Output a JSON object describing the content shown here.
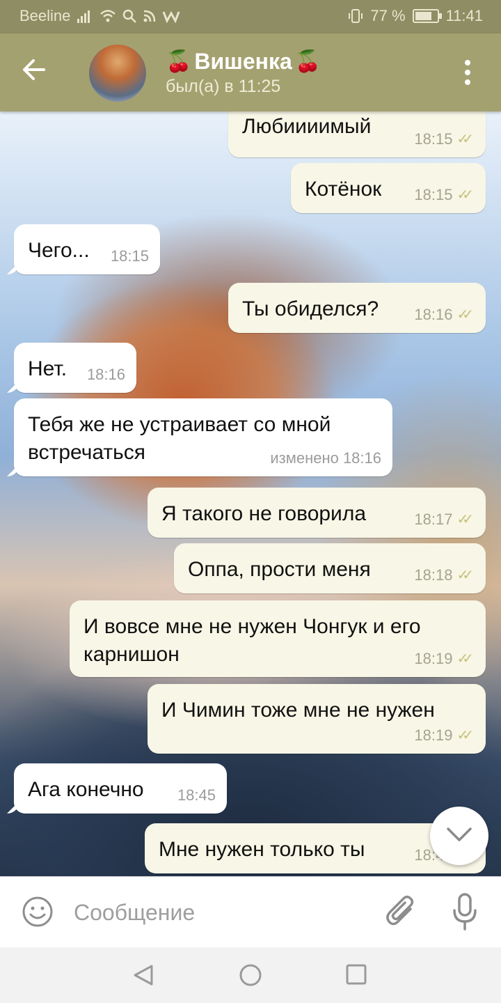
{
  "status_bar": {
    "carrier": "Beeline",
    "battery_text": "77 %",
    "battery_level": 0.77,
    "time": "11:41",
    "icons": [
      "signal-icon",
      "wifi-icon",
      "search-icon",
      "rss-icon",
      "w-icon",
      "vibrate-icon",
      "battery-icon"
    ]
  },
  "header": {
    "contact_name": "Вишенка",
    "name_emoji": "🍒",
    "last_seen": "был(а) в 11:25"
  },
  "messages": [
    {
      "text": "Любиииимый",
      "time": "18:15",
      "outgoing": true,
      "read": true
    },
    {
      "text": "Котёнок",
      "time": "18:15",
      "outgoing": true,
      "read": true
    },
    {
      "text": "Чего...",
      "time": "18:15",
      "outgoing": false
    },
    {
      "text": "Ты обиделся?",
      "time": "18:16",
      "outgoing": true,
      "read": true
    },
    {
      "text": "Нет.",
      "time": "18:16",
      "outgoing": false
    },
    {
      "line1": "Тебя же не устраивает со мной",
      "line2": "встречаться",
      "time": "изменено 18:16",
      "outgoing": false
    },
    {
      "text": "Я такого не говорила",
      "time": "18:17",
      "outgoing": true,
      "read": true
    },
    {
      "text": "Оппа, прости меня",
      "time": "18:18",
      "outgoing": true,
      "read": true
    },
    {
      "line1": "И вовсе мне не нужен Чонгук и его",
      "line2": "карнишон",
      "time": "18:19",
      "outgoing": true,
      "read": true
    },
    {
      "text": "И Чимин тоже мне не нужен",
      "time": "18:19",
      "outgoing": true,
      "read": true
    },
    {
      "text": "Ага конечно",
      "time": "18:45",
      "outgoing": false
    },
    {
      "text": "Мне нужен только ты",
      "time": "18:45",
      "outgoing": true,
      "read": true
    }
  ],
  "input": {
    "placeholder": "Сообщение",
    "value": ""
  },
  "colors": {
    "status_bar": "#8f8d63",
    "toolbar": "#a4a170",
    "outgoing_bubble": "#f8f6e6",
    "incoming_bubble": "#ffffff",
    "read_ticks": "#c7c07a"
  }
}
